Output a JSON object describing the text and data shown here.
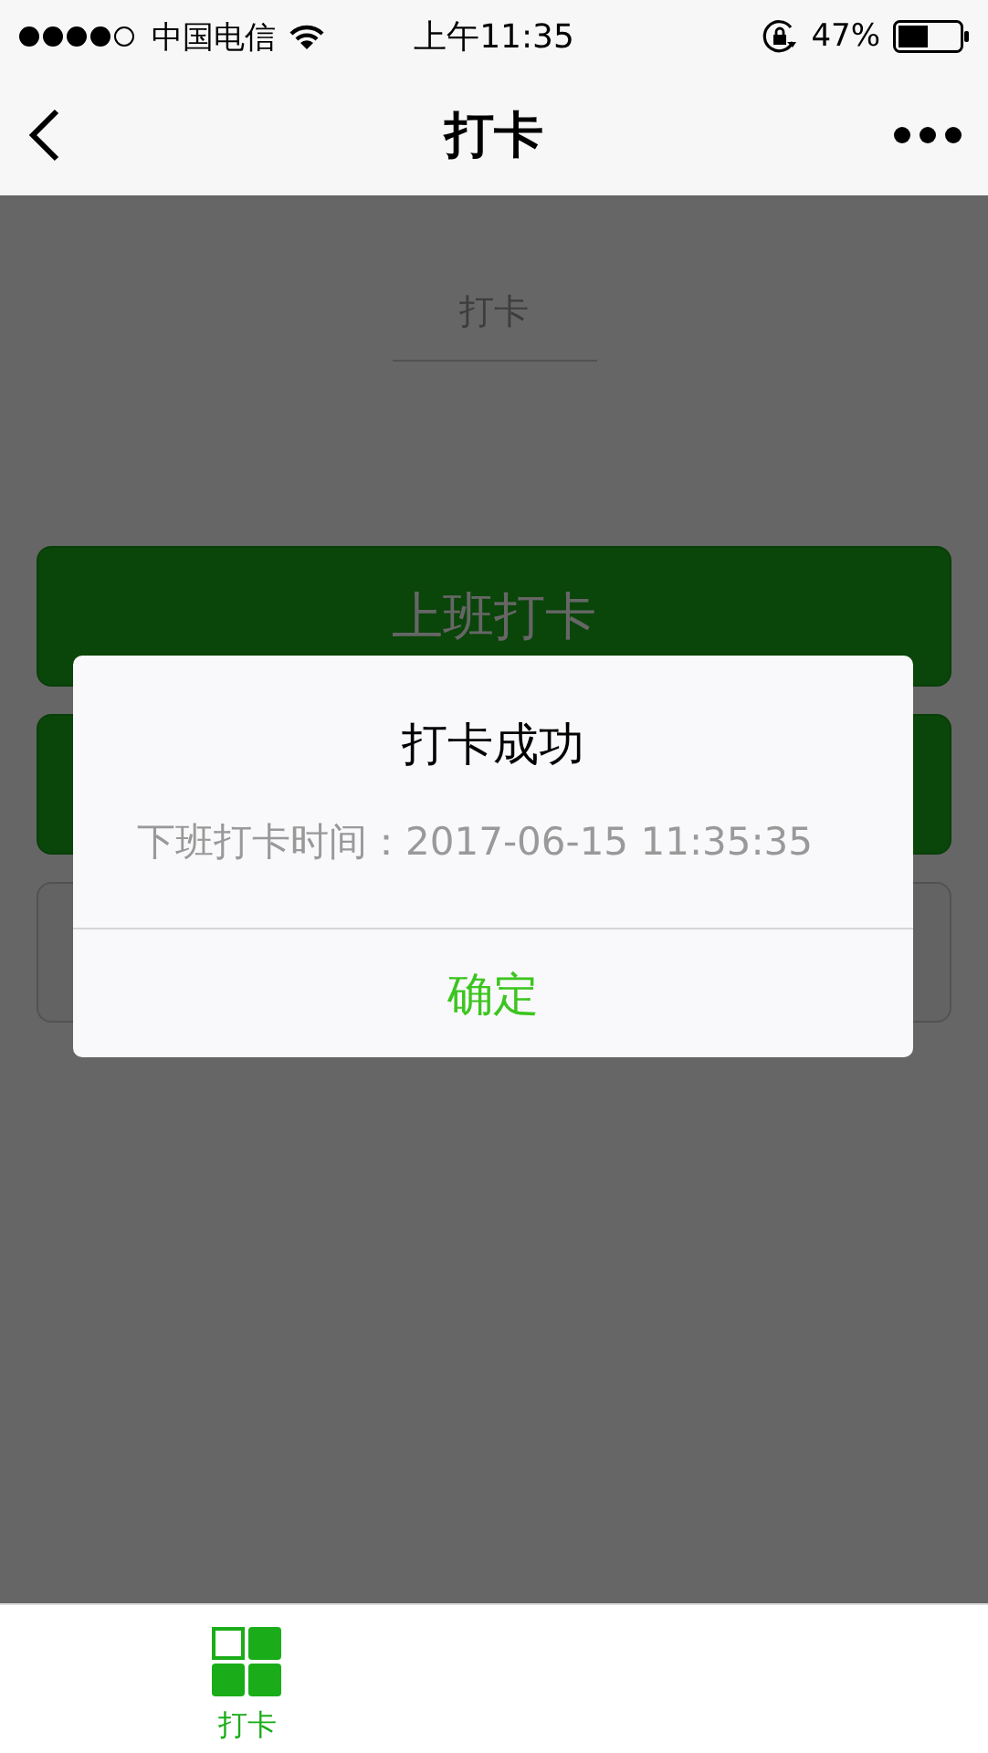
{
  "status_bar": {
    "carrier": "中国电信",
    "time": "上午11:35",
    "battery": "47%"
  },
  "nav": {
    "title": "打卡"
  },
  "field": {
    "placeholder": "打卡"
  },
  "buttons": [
    {
      "kind": "primary",
      "label": "上班打卡"
    },
    {
      "kind": "primary"
    },
    {
      "kind": "outline"
    }
  ],
  "dialog": {
    "title": "打卡成功",
    "message": "下班打卡时间：2017-06-15 11:35:35",
    "confirm": "确定"
  },
  "tabs": [
    {
      "label": "打卡",
      "selected": true
    }
  ]
}
